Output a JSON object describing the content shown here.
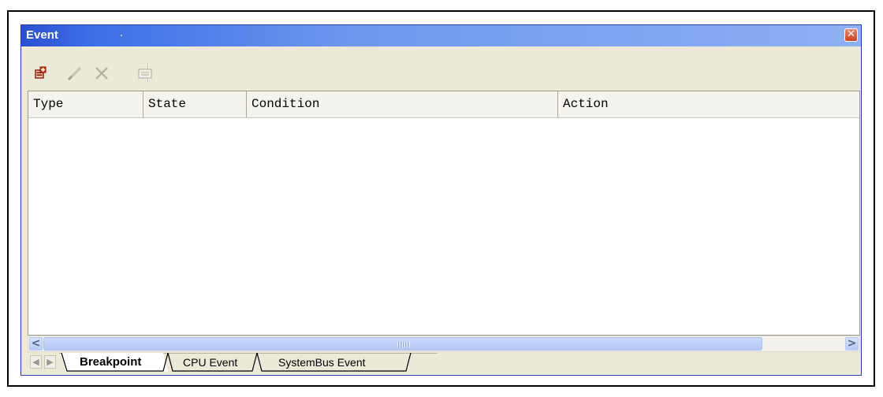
{
  "window": {
    "title": "Event",
    "close_glyph": "✕"
  },
  "toolbar": {
    "buttons": [
      {
        "icon": "new-event-icon",
        "enabled": true
      },
      {
        "icon": "edit-pencil-icon",
        "enabled": false
      },
      {
        "icon": "delete-x-icon",
        "enabled": false
      },
      {
        "icon": "properties-icon",
        "enabled": false
      }
    ]
  },
  "table": {
    "columns": [
      "Type",
      "State",
      "Condition",
      "Action"
    ],
    "rows": []
  },
  "scrollbar": {
    "left_arrow": "<",
    "right_arrow": ">"
  },
  "tabs": {
    "nav_left": "◀",
    "nav_right": "▶",
    "items": [
      {
        "label": "Breakpoint",
        "active": true
      },
      {
        "label": "CPU Event",
        "active": false
      },
      {
        "label": "SystemBus Event",
        "active": false
      }
    ]
  },
  "colors": {
    "titlebar_start": "#2b4fd0",
    "titlebar_end": "#8fb0f2",
    "chrome": "#ece9d8",
    "scrollbar_thumb": "#b3c8f3",
    "close_button": "#c9431f"
  }
}
